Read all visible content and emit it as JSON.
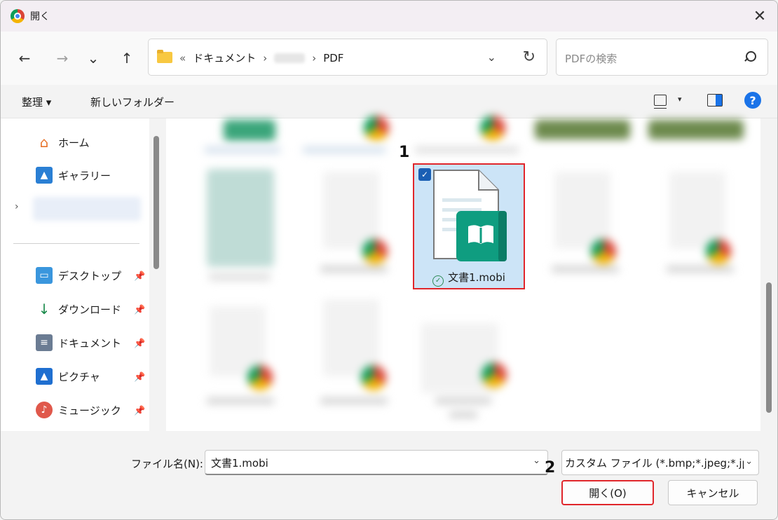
{
  "window": {
    "title": "開く",
    "close_glyph": "✕"
  },
  "nav": {
    "back": "←",
    "forward": "→",
    "recent": "⌄",
    "up": "↑"
  },
  "address": {
    "separator_start": "«",
    "path": [
      "ドキュメント",
      "PDF"
    ],
    "chevron": "⌄",
    "refresh": "↻"
  },
  "search": {
    "placeholder": "PDFの検索"
  },
  "toolbar": {
    "organize_label": "整理 ▾",
    "new_folder_label": "新しいフォルダー",
    "view_chevron": "▾",
    "help_label": "?"
  },
  "sidebar": {
    "home": "ホーム",
    "gallery": "ギャラリー",
    "expand": "›",
    "quick_access": [
      {
        "label": "デスクトップ",
        "icon": "desktop-icon"
      },
      {
        "label": "ダウンロード",
        "icon": "download-icon"
      },
      {
        "label": "ドキュメント",
        "icon": "documents-icon"
      },
      {
        "label": "ピクチャ",
        "icon": "pictures-icon"
      },
      {
        "label": "ミュージック",
        "icon": "music-icon"
      }
    ]
  },
  "files": {
    "selected": {
      "name": "文書1.mobi",
      "check": "✓",
      "sync": "✓"
    }
  },
  "annotations": {
    "step1": "1",
    "step2": "2"
  },
  "bottom": {
    "filename_label": "ファイル名(N):",
    "filename_value": "文書1.mobi",
    "filetype_value": "カスタム ファイル (*.bmp;*.jpeg;*.jp",
    "chevron": "⌄",
    "open_label": "開く(O)",
    "cancel_label": "キャンセル"
  },
  "colors": {
    "selection": "#cce4f7",
    "highlight": "#e0262b",
    "accent": "#1a73e8",
    "book": "#0f9d80"
  }
}
